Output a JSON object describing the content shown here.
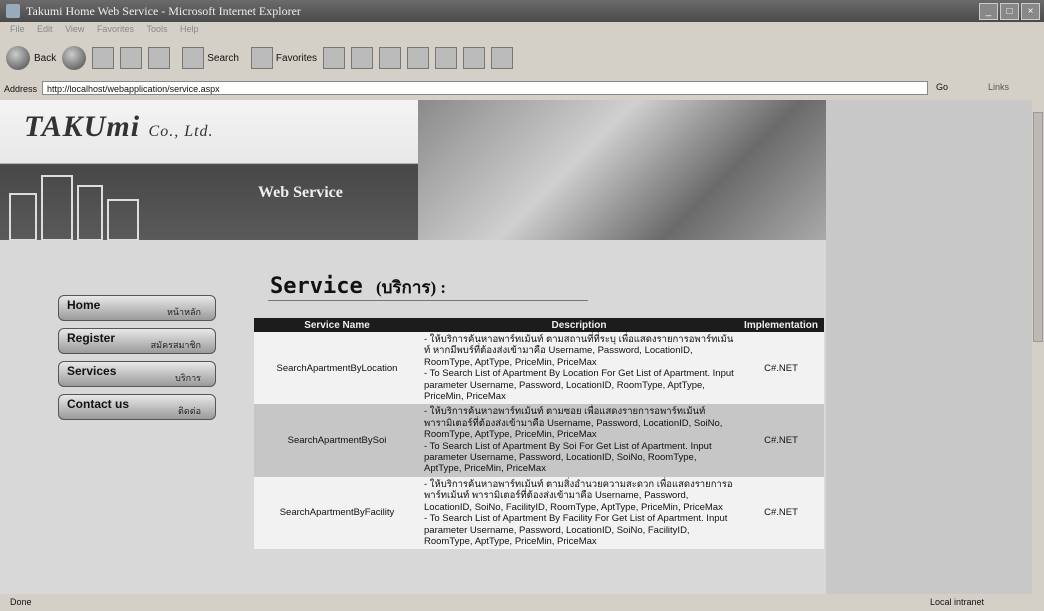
{
  "window": {
    "title": "Takumi Home Web Service - Microsoft Internet Explorer"
  },
  "menu": [
    "File",
    "Edit",
    "View",
    "Favorites",
    "Tools",
    "Help"
  ],
  "toolbar": {
    "back": "Back",
    "search": "Search",
    "favorites": "Favorites"
  },
  "address": {
    "label": "Address",
    "url": "http://localhost/webapplication/service.aspx",
    "go": "Go",
    "links": "Links"
  },
  "header": {
    "logo": "TAKUmi",
    "logo_suffix": "Co., Ltd.",
    "banner": "Web Service"
  },
  "nav": [
    {
      "en": "Home",
      "th": "หน้าหลัก"
    },
    {
      "en": "Register",
      "th": "สมัครสมาชิก"
    },
    {
      "en": "Services",
      "th": "บริการ"
    },
    {
      "en": "Contact us",
      "th": "ติดต่อ"
    }
  ],
  "heading": {
    "en": "Service",
    "th": "(บริการ) :"
  },
  "table": {
    "headers": [
      "Service Name",
      "Description",
      "Implementation"
    ],
    "rows": [
      {
        "name": "SearchApartmentByLocation",
        "desc_th": "- ให้บริการค้นหาอพาร์ทเม้นท์ ตามสถานที่ที่ระบุ เพื่อแสดงรายการอพาร์ทเม้นท์ หากมีพบร์ที่ต้องส่งเข้ามาคือ Username, Password, LocationID, RoomType, AptType, PriceMin, PriceMax",
        "desc_en": "- To Search List of Apartment By Location For Get List of Apartment. Input parameter Username, Password, LocationID, RoomType, AptType, PriceMin, PriceMax",
        "impl": "C#.NET"
      },
      {
        "name": "SearchApartmentBySoi",
        "desc_th": "- ให้บริการค้นหาอพาร์ทเม้นท์ ตามซอย เพื่อแสดงรายการอพาร์ทเม้นท์ พารามิเตอร์ที่ต้องส่งเข้ามาคือ Username, Password, LocationID, SoiNo, RoomType, AptType, PriceMin, PriceMax",
        "desc_en": "- To Search List of Apartment By Soi For Get List of Apartment. Input parameter Username, Password, LocationID, SoiNo, RoomType, AptType, PriceMin, PriceMax",
        "impl": "C#.NET"
      },
      {
        "name": "SearchApartmentByFacility",
        "desc_th": "- ให้บริการค้นหาอพาร์ทเม้นท์ ตามสิ่งอำนวยความสะดวก เพื่อแสดงรายการอพาร์ทเม้นท์ พารามิเตอร์ที่ต้องส่งเข้ามาคือ Username, Password, LocationID, SoiNo, FacilityID, RoomType, AptType, PriceMin, PriceMax",
        "desc_en": "- To Search List of Apartment By Facility For Get List of Apartment. Input parameter Username, Password, LocationID, SoiNo, FacilityID, RoomType, AptType, PriceMin, PriceMax",
        "impl": "C#.NET"
      }
    ]
  },
  "status": {
    "left": "Done",
    "zone": "Local intranet"
  }
}
